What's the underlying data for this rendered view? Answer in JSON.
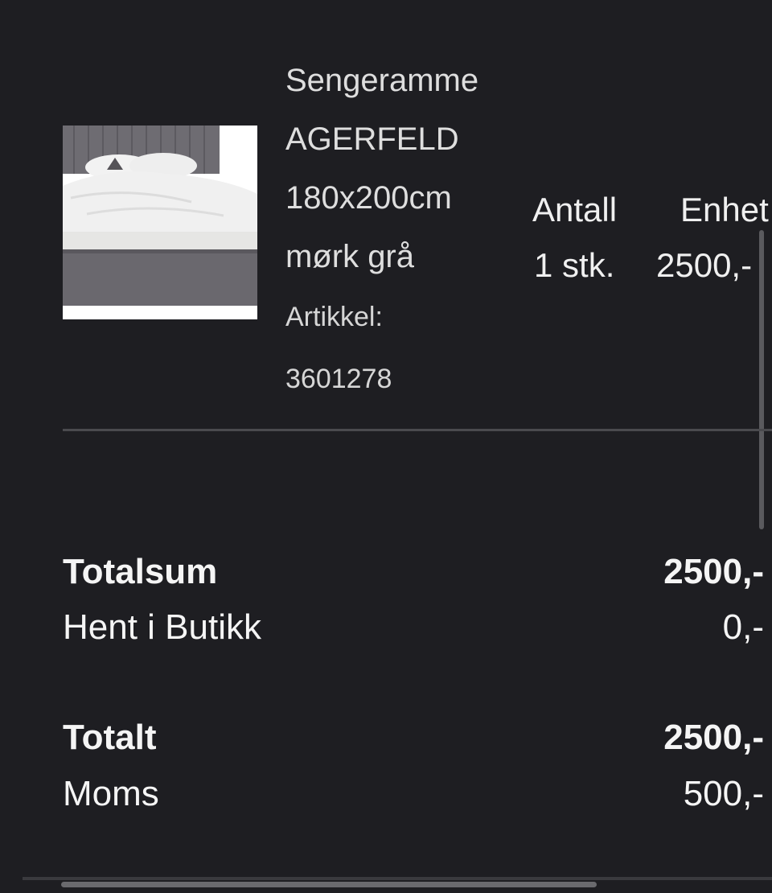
{
  "product": {
    "name_line1": "Sengeramme",
    "name_line2": "AGERFELD",
    "size": "180x200cm",
    "color": "mørk grå",
    "article_label": "Artikkel:",
    "article_number": "3601278",
    "image_icon": "bed-product-image"
  },
  "columns": {
    "quantity_header": "Antall",
    "unit_price_header": "Enhet",
    "quantity_value": "1 stk.",
    "unit_price_value": "2500,-"
  },
  "summary": {
    "subtotal_label": "Totalsum",
    "subtotal_value": "2500,-",
    "shipping_label": "Hent i Butikk",
    "shipping_value": "0,-",
    "total_label": "Totalt",
    "total_value": "2500,-",
    "vat_label": "Moms",
    "vat_value": "500,-"
  },
  "colors": {
    "background": "#1e1e22",
    "text": "#f0f0f0",
    "divider": "#4a4a4e"
  }
}
